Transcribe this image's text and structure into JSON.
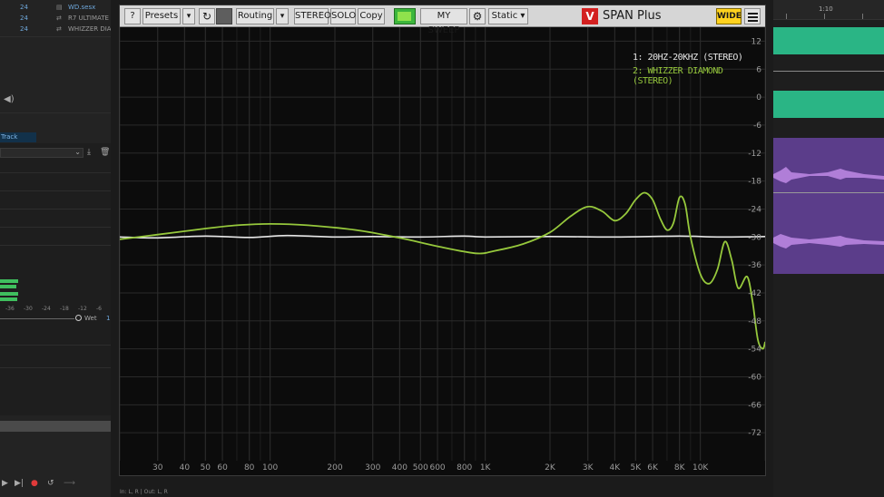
{
  "host": {
    "tracks": [
      {
        "num": "24",
        "name": "WD.sesx",
        "highlight": true
      },
      {
        "num": "24",
        "name": "R7 ULTIMATE",
        "highlight": false
      },
      {
        "num": "24",
        "name": "WHIZZER DIAM",
        "highlight": false
      }
    ],
    "track_effects_tab": "Track Effects",
    "meter_scale": [
      "-36",
      "-30",
      "-24",
      "-18",
      "-12",
      "-6"
    ],
    "wet_label": "Wet",
    "wet_value": "1",
    "status_text": "In: L, R | Out: L, R",
    "timeline_label": "1:10"
  },
  "toolbar": {
    "help_label": "?",
    "presets_label": "Presets",
    "routing_label": "Routing",
    "stereo_label": "STEREO",
    "solo_label": "SOLO",
    "copy_label": "Copy",
    "sweep_label": "MY SWEEP",
    "static_label": "Static ▾",
    "brand_mark": "V",
    "brand_name": "SPAN Plus",
    "wide_label": "WIDE",
    "dropdown_glyph": "▾",
    "refresh_glyph": "↻",
    "gear_glyph": "⚙"
  },
  "legend": {
    "entry1": "1: 20HZ-20KHZ (STEREO)",
    "entry2": "2: WHIZZER DIAMOND (STEREO)"
  },
  "colors": {
    "series1": "#e6e6e6",
    "series2": "#96c83c",
    "accent": "#ffd21e"
  },
  "chart_data": {
    "type": "line",
    "x_scale": "log",
    "xlim": [
      20,
      20000
    ],
    "ylim": [
      -78,
      15
    ],
    "x_ticks": [
      {
        "value": 30,
        "label": "30"
      },
      {
        "value": 40,
        "label": "40"
      },
      {
        "value": 50,
        "label": "50"
      },
      {
        "value": 60,
        "label": "60"
      },
      {
        "value": 80,
        "label": "80"
      },
      {
        "value": 100,
        "label": "100"
      },
      {
        "value": 200,
        "label": "200"
      },
      {
        "value": 300,
        "label": "300"
      },
      {
        "value": 400,
        "label": "400"
      },
      {
        "value": 500,
        "label": "500"
      },
      {
        "value": 600,
        "label": "600"
      },
      {
        "value": 800,
        "label": "800"
      },
      {
        "value": 1000,
        "label": "1K"
      },
      {
        "value": 2000,
        "label": "2K"
      },
      {
        "value": 3000,
        "label": "3K"
      },
      {
        "value": 4000,
        "label": "4K"
      },
      {
        "value": 5000,
        "label": "5K"
      },
      {
        "value": 6000,
        "label": "6K"
      },
      {
        "value": 8000,
        "label": "8K"
      },
      {
        "value": 10000,
        "label": "10K"
      }
    ],
    "y_ticks": [
      12,
      6,
      0,
      -6,
      -12,
      -18,
      -24,
      -30,
      -36,
      -42,
      -48,
      -54,
      -60,
      -66,
      -72
    ],
    "grid": true,
    "legend_position": "top-right",
    "series": [
      {
        "name": "1: 20HZ-20KHZ (STEREO)",
        "color": "#e6e6e6",
        "points": [
          [
            20,
            -30
          ],
          [
            30,
            -30.2
          ],
          [
            50,
            -29.8
          ],
          [
            80,
            -30.1
          ],
          [
            120,
            -29.7
          ],
          [
            200,
            -30.0
          ],
          [
            300,
            -29.9
          ],
          [
            500,
            -30.0
          ],
          [
            800,
            -29.8
          ],
          [
            1000,
            -30.0
          ],
          [
            2000,
            -29.9
          ],
          [
            4000,
            -30.0
          ],
          [
            8000,
            -29.8
          ],
          [
            12000,
            -30.0
          ],
          [
            20000,
            -29.9
          ]
        ]
      },
      {
        "name": "2: WHIZZER DIAMOND (STEREO)",
        "color": "#96c83c",
        "points": [
          [
            20,
            -30.5
          ],
          [
            30,
            -29.5
          ],
          [
            50,
            -28.2
          ],
          [
            70,
            -27.5
          ],
          [
            100,
            -27.2
          ],
          [
            150,
            -27.5
          ],
          [
            250,
            -28.5
          ],
          [
            400,
            -30.2
          ],
          [
            600,
            -32.0
          ],
          [
            900,
            -33.5
          ],
          [
            1100,
            -33.0
          ],
          [
            1500,
            -31.5
          ],
          [
            2000,
            -29.0
          ],
          [
            2500,
            -25.5
          ],
          [
            3000,
            -23.5
          ],
          [
            3500,
            -24.5
          ],
          [
            4000,
            -26.5
          ],
          [
            4500,
            -25.0
          ],
          [
            5000,
            -22.0
          ],
          [
            5500,
            -20.5
          ],
          [
            6000,
            -22.0
          ],
          [
            6500,
            -26.0
          ],
          [
            7000,
            -28.5
          ],
          [
            7500,
            -27.0
          ],
          [
            8000,
            -21.5
          ],
          [
            8500,
            -23.0
          ],
          [
            9000,
            -30.0
          ],
          [
            10000,
            -38.0
          ],
          [
            11000,
            -40.0
          ],
          [
            12000,
            -37.0
          ],
          [
            13000,
            -31.0
          ],
          [
            14000,
            -35.0
          ],
          [
            15000,
            -41.0
          ],
          [
            16500,
            -38.5
          ],
          [
            17500,
            -44.0
          ],
          [
            18500,
            -52.0
          ],
          [
            19500,
            -54.0
          ],
          [
            20000,
            -52.5
          ]
        ]
      }
    ]
  }
}
